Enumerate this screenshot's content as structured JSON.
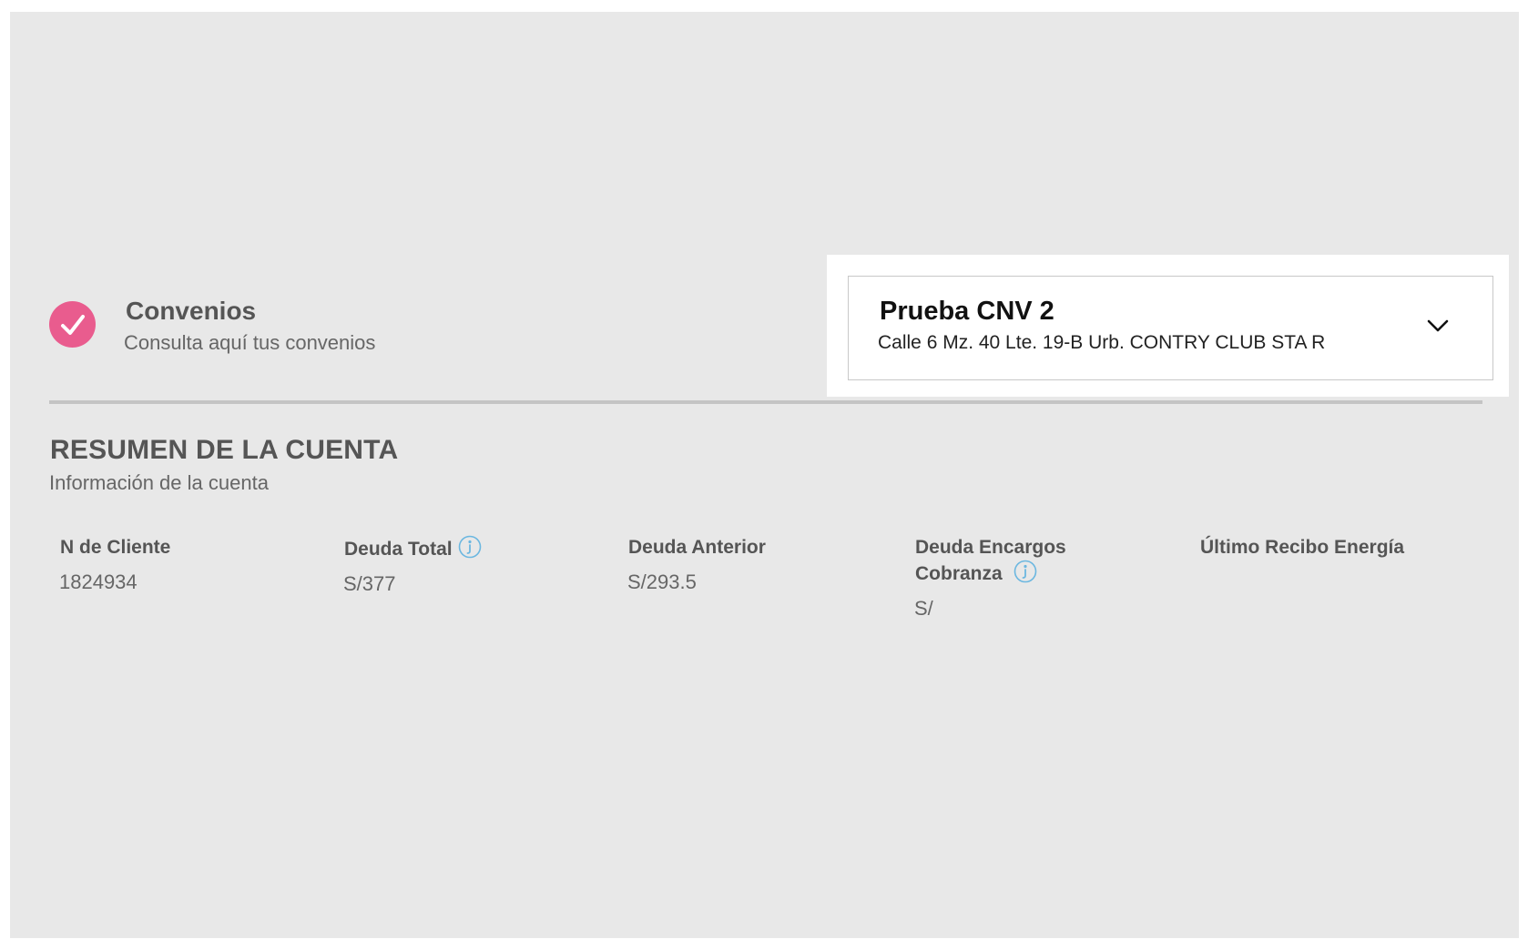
{
  "agreements": {
    "title": "Convenios",
    "subtitle": "Consulta aquí tus convenios",
    "accent_color": "#e95c8e",
    "icon": "check-circle-icon"
  },
  "account_selector": {
    "name": "Prueba CNV 2",
    "address": "Calle 6 Mz. 40 Lte. 19-B Urb. CONTRY CLUB STA R",
    "icon": "chevron-down-icon"
  },
  "summary": {
    "title": "RESUMEN DE LA CUENTA",
    "subtitle": "Información de la cuenta",
    "columns": [
      {
        "label": "N de Cliente",
        "value": "1824934"
      },
      {
        "label": "Deuda Total",
        "value": "S/377",
        "info_icon": "info-icon"
      },
      {
        "label": "Deuda Anterior",
        "value": "S/293.5"
      },
      {
        "label_line1": "Deuda Encargos",
        "label_line2": "Cobranza",
        "value": "S/",
        "info_icon": "info-icon"
      },
      {
        "label": "Último Recibo Energía",
        "value": ""
      }
    ],
    "info_icon_color": "#6bb7e0"
  }
}
